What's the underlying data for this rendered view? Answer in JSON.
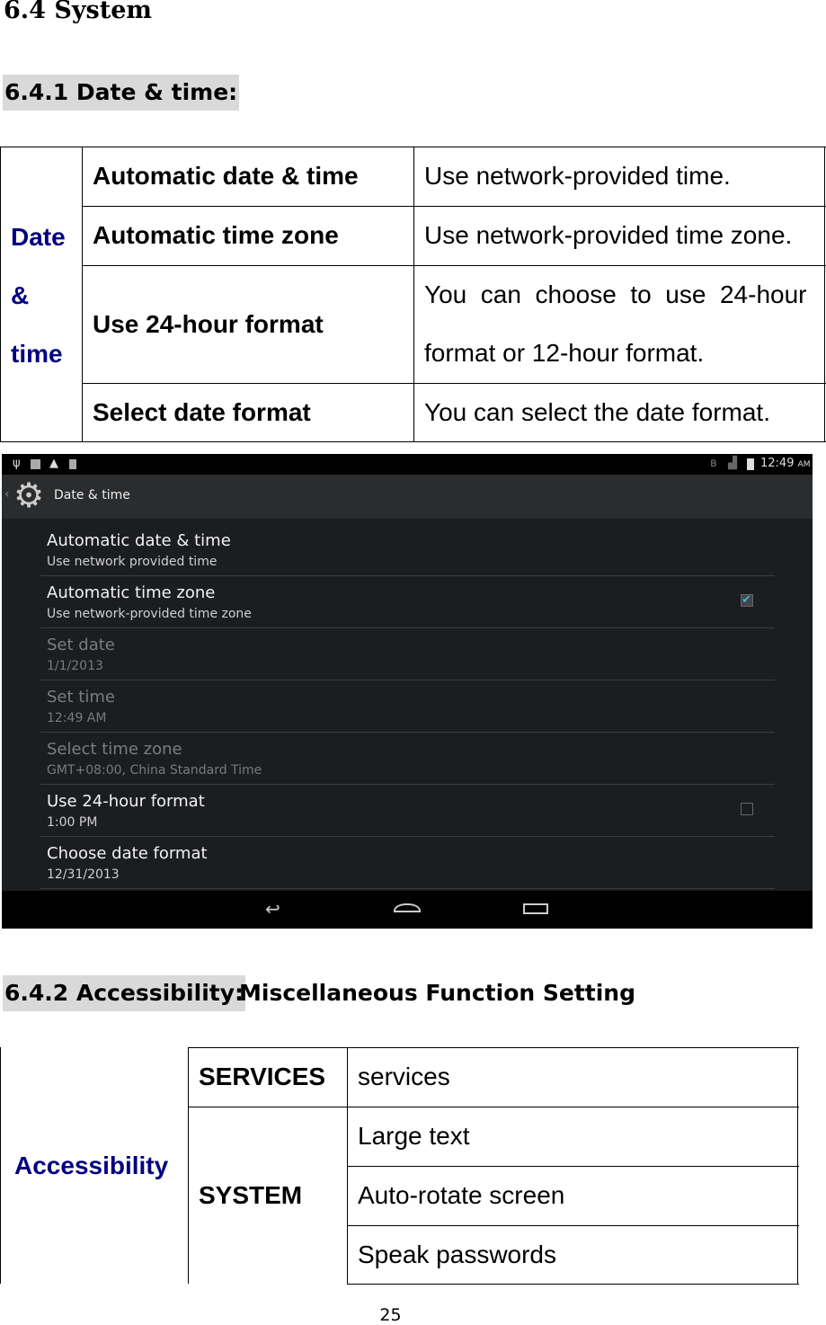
{
  "heading": "6.4 System",
  "section1": {
    "title": "6.4.1 Date & time:",
    "row_header": [
      "Date",
      "&",
      "time"
    ],
    "rows": [
      {
        "name": "Automatic date & time",
        "desc": "Use network-provided time."
      },
      {
        "name": "Automatic time zone",
        "desc": "Use network-provided time zone."
      },
      {
        "name": "Use 24-hour format",
        "desc_lines": [
          "You  can  choose  to  use  24-hour",
          "format or 12-hour format."
        ]
      },
      {
        "name": "Select date format",
        "desc": "You can select the date format."
      }
    ]
  },
  "screenshot": {
    "clock": "12:49",
    "ampm": "AM",
    "title": "Date & time",
    "items": [
      {
        "title": "Automatic date & time",
        "summary": "Use network provided time"
      },
      {
        "title": "Automatic time zone",
        "summary": "Use network-provided time zone",
        "checked": true
      },
      {
        "title": "Set date",
        "summary": "1/1/2013",
        "disabled": true
      },
      {
        "title": "Set time",
        "summary": "12:49 AM",
        "disabled": true
      },
      {
        "title": "Select time zone",
        "summary": "GMT+08:00, China Standard Time",
        "disabled": true
      },
      {
        "title": "Use 24-hour format",
        "summary": "1:00 PM",
        "checked": false
      },
      {
        "title": "Choose date format",
        "summary": "12/31/2013"
      }
    ],
    "accent": "#33b5e5"
  },
  "section2": {
    "title": "6.4.2 Accessibility:",
    "subtitle": "Miscellaneous Function Setting",
    "row_header": "Accessibility",
    "groups": [
      {
        "name": "SERVICES",
        "items": [
          "services"
        ]
      },
      {
        "name": "SYSTEM",
        "items": [
          "Large text",
          "Auto-rotate screen",
          "Speak passwords"
        ]
      }
    ]
  },
  "page_number": "25"
}
